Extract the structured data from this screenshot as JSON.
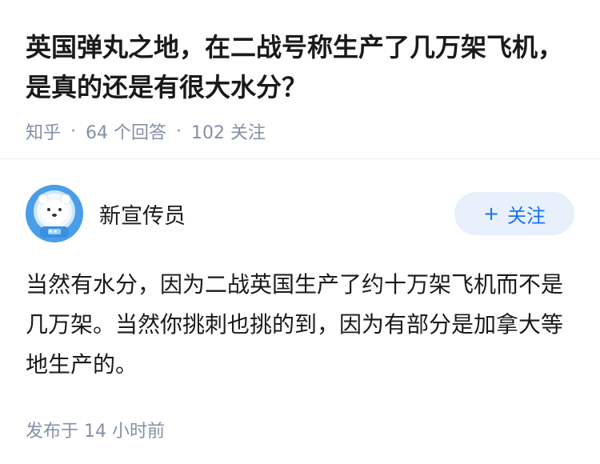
{
  "question": {
    "title": "英国弹丸之地，在二战号称生产了几万架飞机，是真的还是有很大水分？",
    "source": "知乎",
    "separator": "·",
    "answers_count": "64 个回答",
    "followers_count": "102 关注"
  },
  "answer": {
    "author": {
      "name": "新宣传员",
      "avatar_icon": "astronaut-bear-avatar",
      "accent_color": "#4a9ee8"
    },
    "follow_button": {
      "plus": "+",
      "label": "关注"
    },
    "content": "当然有水分，因为二战英国生产了约十万架飞机而不是几万架。当然你挑刺也挑的到，因为有部分是加拿大等地生产的。",
    "published": "发布于  14 小时前"
  },
  "colors": {
    "accent": "#1772f6",
    "button_bg": "#e8f0fb",
    "meta_text": "#8590a6",
    "primary_text": "#1a1a1a"
  }
}
